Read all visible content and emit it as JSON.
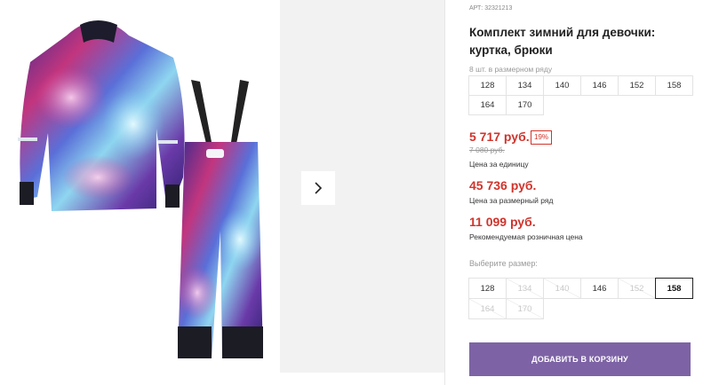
{
  "gallery": {
    "next_icon": "chevron-right-icon"
  },
  "product": {
    "article": "АРТ: 32321213",
    "title": "Комплект зимний для девочки: куртка, брюки",
    "row_note": "8 шт. в размерном ряду",
    "row_sizes": [
      "128",
      "134",
      "140",
      "146",
      "152",
      "158",
      "164",
      "170"
    ]
  },
  "prices": {
    "unit_price": "5 717 руб.",
    "discount_badge": "19%",
    "old_price": "7 080 руб.",
    "unit_label": "Цена за единицу",
    "row_price": "45 736 руб.",
    "row_label": "Цена за размерный ряд",
    "retail_price": "11 099 руб.",
    "retail_label": "Рекомендуемая розничная цена"
  },
  "size_picker": {
    "label": "Выберите размер:",
    "sizes": [
      {
        "value": "128",
        "available": true,
        "selected": false
      },
      {
        "value": "134",
        "available": false,
        "selected": false
      },
      {
        "value": "140",
        "available": false,
        "selected": false
      },
      {
        "value": "146",
        "available": true,
        "selected": false
      },
      {
        "value": "152",
        "available": false,
        "selected": false
      },
      {
        "value": "158",
        "available": true,
        "selected": true
      },
      {
        "value": "164",
        "available": false,
        "selected": false
      },
      {
        "value": "170",
        "available": false,
        "selected": false
      }
    ]
  },
  "actions": {
    "add_to_cart": "ДОБАВИТЬ В КОРЗИНУ"
  },
  "colors": {
    "accent": "#7d63a5",
    "price_red": "#d0342c"
  }
}
